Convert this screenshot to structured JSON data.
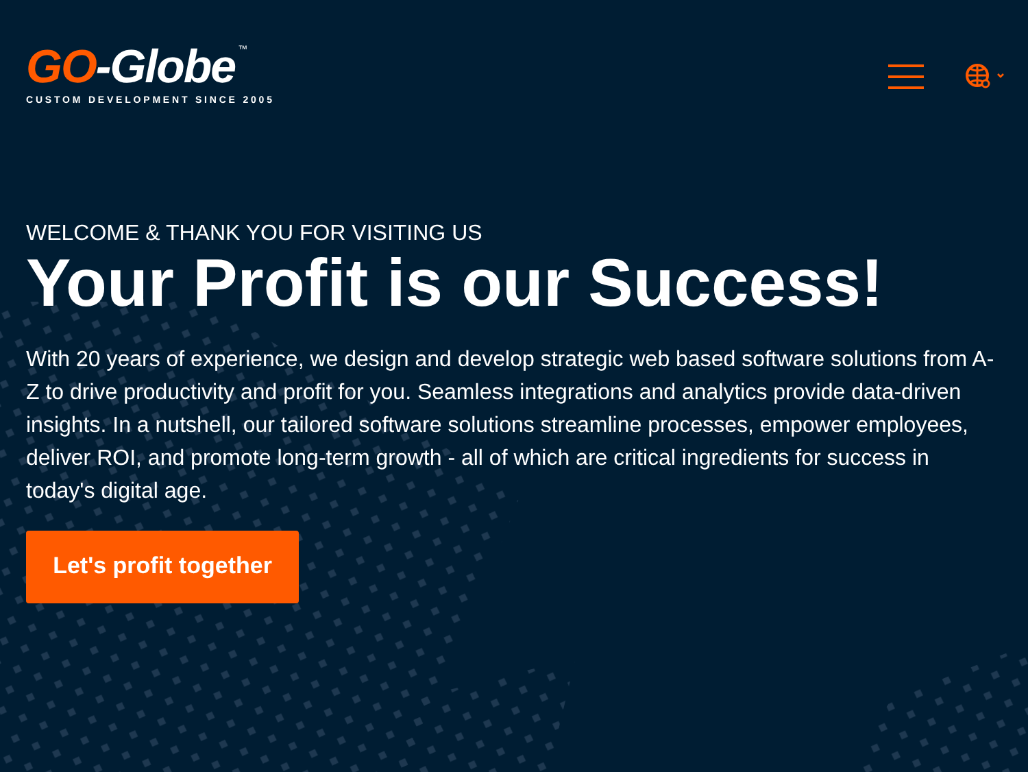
{
  "header": {
    "logo": {
      "accent": "GO",
      "rest": "-Globe",
      "trademark": "™",
      "tagline": "CUSTOM DEVELOPMENT SINCE 2005"
    }
  },
  "hero": {
    "eyebrow": "WELCOME & THANK YOU FOR VISITING US",
    "title": "Your Profit is our Success!",
    "body": "With 20 years of experience, we design and develop strategic web based software solutions from A-Z to drive productivity and profit for you. Seamless integrations and analytics provide data-driven insights. In a nutshell, our tailored software solutions streamline processes, empower employees, deliver ROI, and promote long-term growth - all of which are critical ingredients for success in today's digital age.",
    "button": "Let's profit together"
  }
}
